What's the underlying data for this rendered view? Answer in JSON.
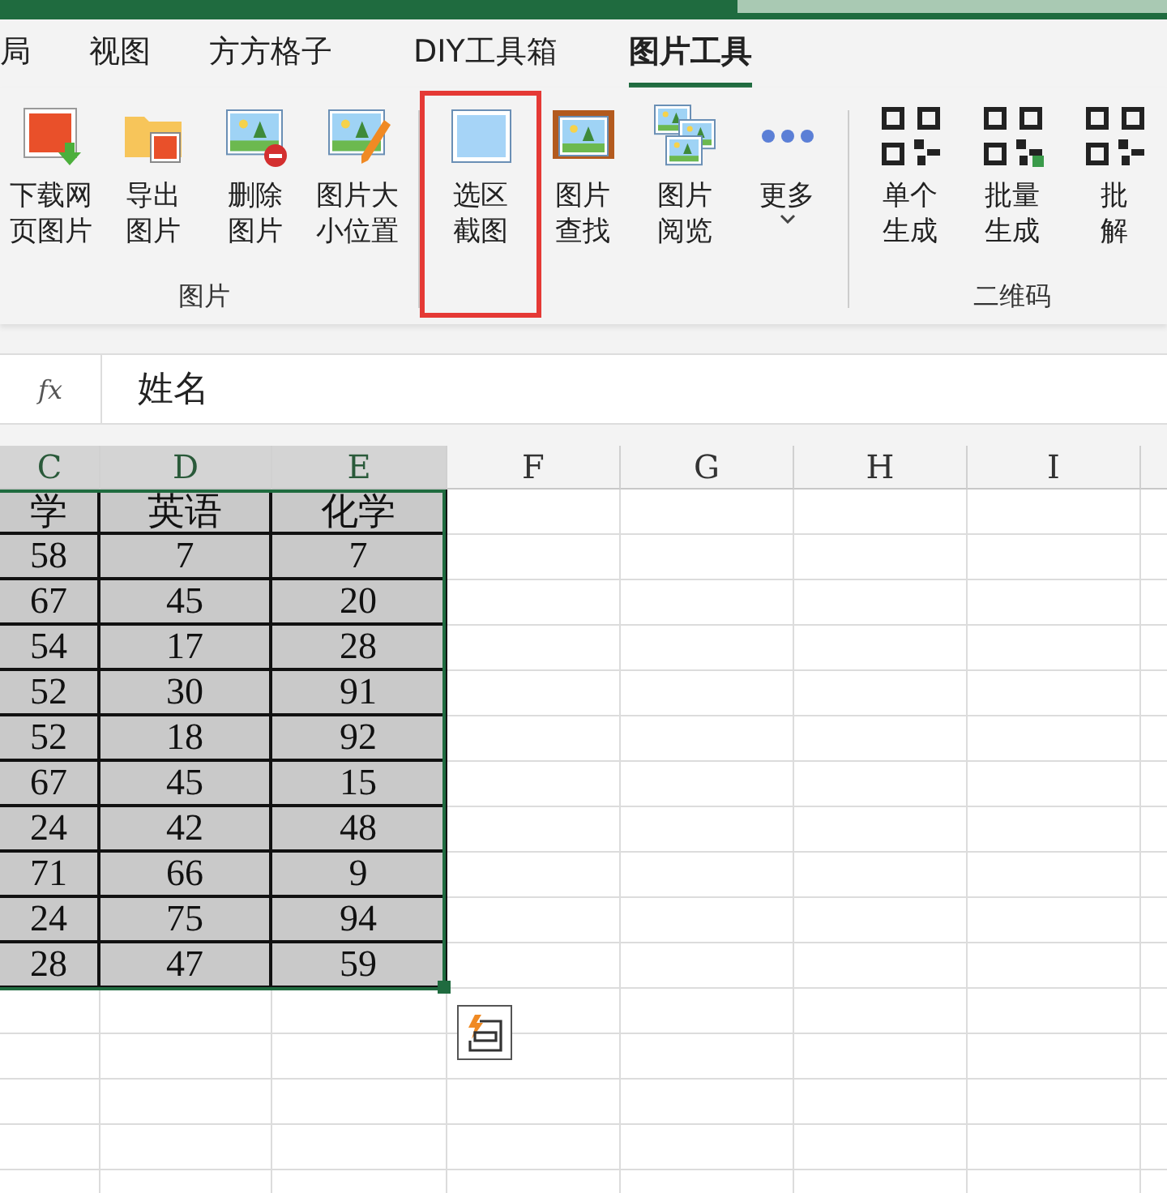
{
  "tabs": [
    {
      "label": "局",
      "selected": false
    },
    {
      "label": "视图",
      "selected": false
    },
    {
      "label": "方方格子",
      "selected": false
    },
    {
      "label": "DIY工具箱",
      "selected": false
    },
    {
      "label": "图片工具",
      "selected": true
    }
  ],
  "ribbon": {
    "groups": [
      {
        "label": "图片",
        "items": [
          {
            "kind": "download",
            "lines": [
              "下载网",
              "页图片"
            ],
            "highlighted": false
          },
          {
            "kind": "export",
            "lines": [
              "导出",
              "图片"
            ],
            "highlighted": false
          },
          {
            "kind": "delete",
            "lines": [
              "删除",
              "图片"
            ],
            "highlighted": false
          },
          {
            "kind": "resize",
            "lines": [
              "图片大",
              "小位置"
            ],
            "highlighted": false
          }
        ]
      },
      {
        "items": [
          {
            "kind": "screenshot",
            "lines": [
              "选区",
              "截图"
            ],
            "highlighted": true
          },
          {
            "kind": "find",
            "lines": [
              "图片",
              "查找"
            ],
            "highlighted": false
          },
          {
            "kind": "browse",
            "lines": [
              "图片",
              "阅览"
            ],
            "highlighted": false
          },
          {
            "kind": "more",
            "lines": [
              "更多"
            ],
            "dropdown": true,
            "highlighted": false
          }
        ]
      },
      {
        "label": "二维码",
        "items": [
          {
            "kind": "qr",
            "lines": [
              "单个",
              "生成"
            ],
            "highlighted": false
          },
          {
            "kind": "qr-batch",
            "lines": [
              "批量",
              "生成"
            ],
            "highlighted": false
          },
          {
            "kind": "qr",
            "lines": [
              "批",
              "解"
            ],
            "highlighted": false
          }
        ]
      }
    ]
  },
  "formula_bar": {
    "fx": "fx",
    "value": "姓名"
  },
  "sheet": {
    "columns": [
      {
        "label": "C",
        "selected": true
      },
      {
        "label": "D",
        "selected": true
      },
      {
        "label": "E",
        "selected": true
      },
      {
        "label": "F",
        "selected": false
      },
      {
        "label": "G",
        "selected": false
      },
      {
        "label": "H",
        "selected": false
      },
      {
        "label": "I",
        "selected": false
      }
    ],
    "rows": [
      [
        "学",
        "英语",
        "化学"
      ],
      [
        "58",
        "7",
        "7"
      ],
      [
        "67",
        "45",
        "20"
      ],
      [
        "54",
        "17",
        "28"
      ],
      [
        "52",
        "30",
        "91"
      ],
      [
        "52",
        "18",
        "92"
      ],
      [
        "67",
        "45",
        "15"
      ],
      [
        "24",
        "42",
        "48"
      ],
      [
        "71",
        "66",
        "9"
      ],
      [
        "24",
        "75",
        "94"
      ],
      [
        "28",
        "47",
        "59"
      ]
    ]
  }
}
